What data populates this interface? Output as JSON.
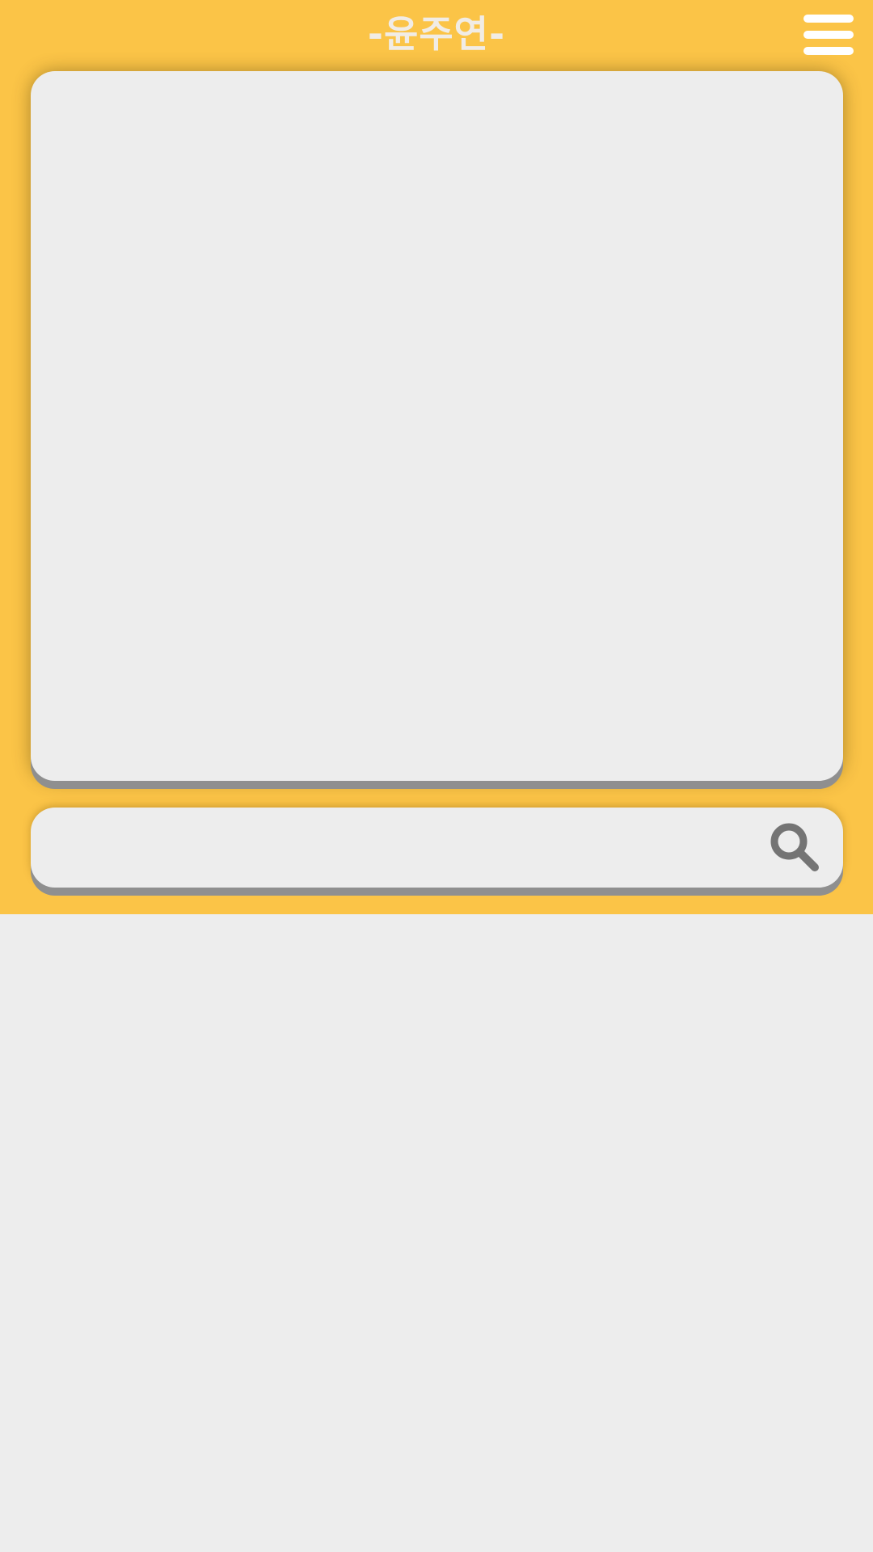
{
  "header": {
    "title": "-윤주연-",
    "background_color": "#fbc447",
    "menu_icon": "hamburger-menu-icon"
  },
  "search": {
    "value": "",
    "placeholder": "",
    "icon": "search-icon",
    "icon_color": "#747474"
  },
  "colors": {
    "page_background": "#ededed",
    "panel_background": "#ededed",
    "panel_shadow": "#8f8f8f",
    "title_color": "#f1ece5"
  }
}
